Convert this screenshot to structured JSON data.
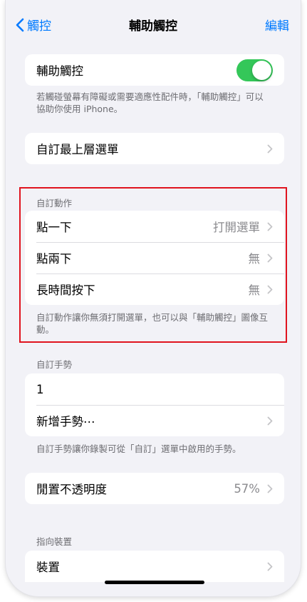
{
  "nav": {
    "back_label": "觸控",
    "title": "輔助觸控",
    "edit_label": "編輯"
  },
  "assistive_touch": {
    "label": "輔助觸控",
    "enabled": true,
    "footnote": "若觸碰螢幕有障礙或需要適應性配件時，「輔助觸控」可以協助你使用 iPhone。"
  },
  "top_menu": {
    "label": "自訂最上層選單"
  },
  "custom_actions": {
    "header": "自訂動作",
    "items": [
      {
        "label": "點一下",
        "value": "打開選單"
      },
      {
        "label": "點兩下",
        "value": "無"
      },
      {
        "label": "長時間按下",
        "value": "無"
      }
    ],
    "footnote": "自訂動作讓你無須打開選單，也可以與「輔助觸控」圖像互動。"
  },
  "custom_gestures": {
    "header": "自訂手勢",
    "items": [
      {
        "label": "1"
      },
      {
        "label": "新增手勢⋯"
      }
    ],
    "footnote": "自訂手勢讓你錄製可從「自訂」選單中啟用的手勢。"
  },
  "idle_opacity": {
    "label": "閒置不透明度",
    "value": "57%"
  },
  "pointer_devices": {
    "header": "指向裝置",
    "items": [
      {
        "label": "裝置"
      }
    ]
  },
  "colors": {
    "accent": "#007aff",
    "toggle_on": "#34c759",
    "highlight": "#e0141e"
  }
}
